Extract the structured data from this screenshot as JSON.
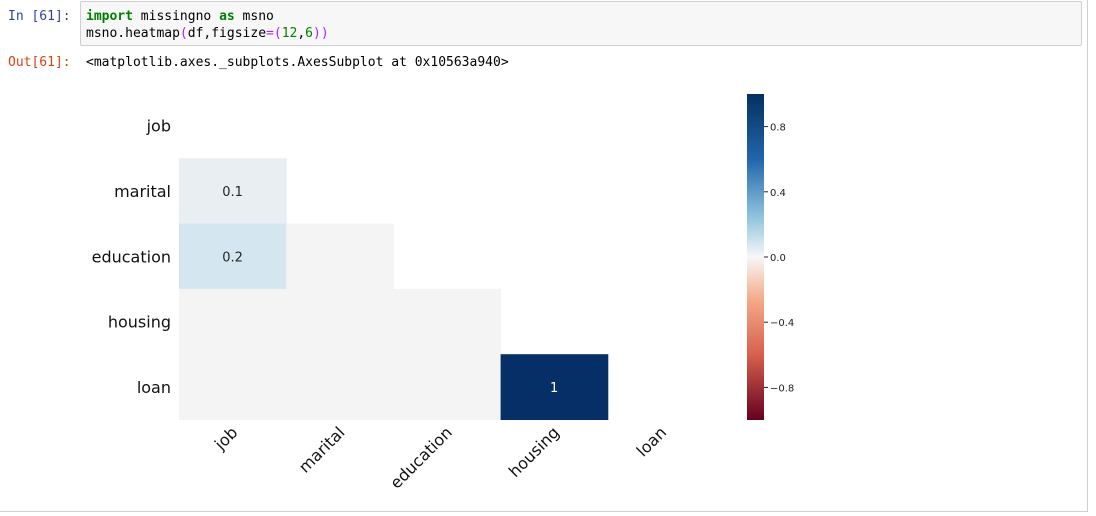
{
  "cell": {
    "in_prompt": "In [61]:",
    "code_line1": {
      "kw1": "import",
      "t1": " missingno ",
      "kw2": "as",
      "t2": " msno"
    },
    "code_line2": {
      "t1": "msno.heatmap",
      "p1": "(",
      "t2": "df,figsize",
      "eq": "=",
      "p2": "(",
      "n1": "12",
      "comma": ",",
      "n2": "6",
      "p3": "))"
    },
    "out_prompt": "Out[61]:",
    "out_text": "<matplotlib.axes._subplots.AxesSubplot at 0x10563a940>"
  },
  "chart_data": {
    "type": "heatmap",
    "row_labels": [
      "job",
      "marital",
      "education",
      "housing",
      "loan"
    ],
    "col_labels": [
      "job",
      "marital",
      "education",
      "housing",
      "loan"
    ],
    "cells": [
      {
        "row": "marital",
        "col": "job",
        "value": 0.1,
        "label": "0.1"
      },
      {
        "row": "education",
        "col": "job",
        "value": 0.2,
        "label": "0.2"
      },
      {
        "row": "education",
        "col": "marital",
        "value": 0.0,
        "label": ""
      },
      {
        "row": "housing",
        "col": "job",
        "value": 0.0,
        "label": ""
      },
      {
        "row": "housing",
        "col": "marital",
        "value": 0.0,
        "label": ""
      },
      {
        "row": "housing",
        "col": "education",
        "value": 0.0,
        "label": ""
      },
      {
        "row": "loan",
        "col": "job",
        "value": 0.0,
        "label": ""
      },
      {
        "row": "loan",
        "col": "marital",
        "value": 0.0,
        "label": ""
      },
      {
        "row": "loan",
        "col": "education",
        "value": 0.0,
        "label": ""
      },
      {
        "row": "loan",
        "col": "housing",
        "value": 1.0,
        "label": "1"
      }
    ],
    "colorbar": {
      "range": [
        -1,
        1
      ],
      "ticks": [
        {
          "value": 0.8,
          "label": "0.8"
        },
        {
          "value": 0.4,
          "label": "0.4"
        },
        {
          "value": 0.0,
          "label": "0.0"
        },
        {
          "value": -0.4,
          "label": "−0.4"
        },
        {
          "value": -0.8,
          "label": "−0.8"
        }
      ],
      "colors": {
        "top": "#053061",
        "mid_high": "#2166ac",
        "light_high": "#92c5de",
        "mid": "#f7f7f7",
        "light_low": "#f4a582",
        "mid_low": "#d6604d",
        "bottom": "#67001f"
      }
    },
    "colors": {
      "cell_0.1": "#e8eef2",
      "cell_0.2": "#d4e6f0",
      "cell_zero": "#f4f4f4",
      "cell_1": "#052f66"
    },
    "title": "",
    "xlabel": "",
    "ylabel": ""
  }
}
